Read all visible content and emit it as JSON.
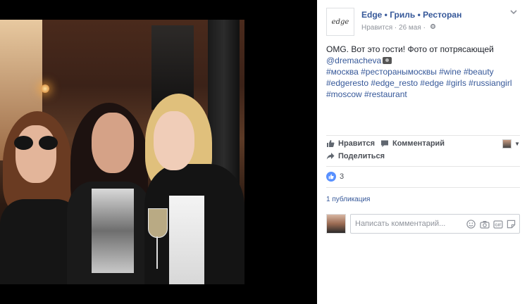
{
  "post": {
    "page_logo_text": "edge",
    "page_name": "Edge • Гриль • Ресторан",
    "meta_reaction": "Нравится",
    "meta_date": "26 мая",
    "meta_separator": " · ",
    "text_line1": "OMG. Вот это гости! Фото от потрясающей",
    "text_mention": "@dremacheva",
    "hashtags_1": "#москва #ресторанымосквы #wine #beauty",
    "hashtags_2": "#edgeresto #edge_resto #edge #girls #russiangirl",
    "hashtags_3": "#moscow #restaurant"
  },
  "actions": {
    "like_label": "Нравится",
    "comment_label": "Комментарий",
    "share_label": "Поделиться"
  },
  "reactions": {
    "count": "3"
  },
  "shares": {
    "label": "1 публикация"
  },
  "comment_box": {
    "placeholder": "Написать комментарий..."
  },
  "colors": {
    "link": "#365899",
    "like_blue": "#5890ff",
    "photo_bg": "#000000"
  },
  "icons": [
    "gear-icon",
    "chevron-down-icon",
    "thumbs-up-icon",
    "comment-icon",
    "share-icon",
    "smiley-icon",
    "camera-icon",
    "gif-icon",
    "sticker-icon"
  ]
}
